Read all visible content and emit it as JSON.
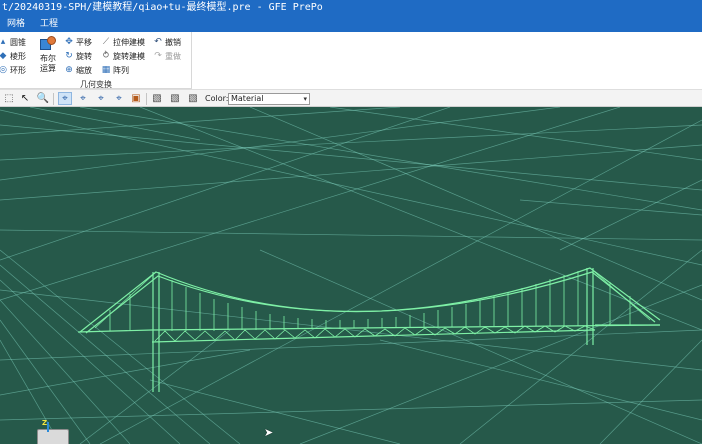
{
  "window": {
    "title": "t/20240319-SPH/建模教程/qiao+tu-最终模型.pre - GFE PrePo"
  },
  "menu": {
    "items": [
      "网格",
      "工程"
    ]
  },
  "ribbon": {
    "left_items": [
      "圆锥",
      "棱形",
      "环形"
    ],
    "bool_label_1": "布尔",
    "bool_label_2": "运算",
    "transform_items": [
      "平移",
      "旋转",
      "缩放"
    ],
    "model_items": [
      "拉伸建模",
      "旋转建模",
      "阵列"
    ],
    "edit_items": [
      "撤销",
      "重做"
    ],
    "group_label": "几何变换"
  },
  "toolbar": {
    "color_label": "Color:",
    "color_value": "Material"
  },
  "viewport": {
    "axis_label": "Z",
    "background": "#26594a",
    "mesh_color": "#7fd1c0",
    "bridge_color": "#7ef0a6"
  }
}
